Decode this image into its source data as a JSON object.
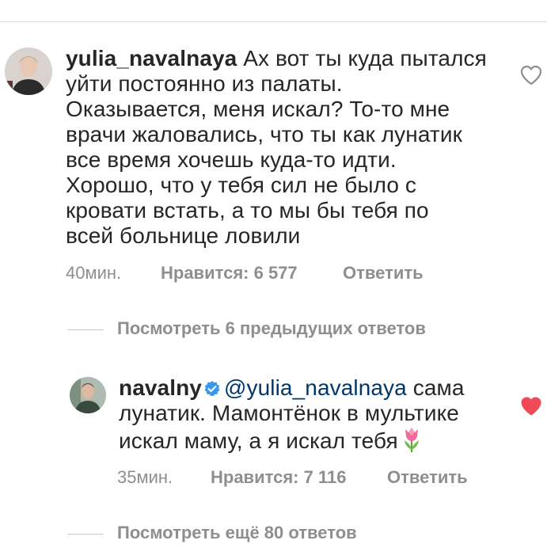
{
  "comments": [
    {
      "username": "yulia_navalnaya",
      "lines": [
        "Ах вот ты куда пытался",
        "уйти постоянно из палаты.",
        "Оказывается, меня искал? То-то мне",
        "врачи жаловались, что ты как лунатик",
        "все время хочешь куда-то идти.",
        "Хорошо, что у тебя сил не было с",
        "кровати встать, а то мы бы тебя по",
        "всей больнице ловили"
      ],
      "time": "40мин.",
      "likes": "Нравится: 6 577",
      "reply_label": "Ответить",
      "liked": false,
      "heart_color": "#8e8e8e"
    },
    {
      "username": "navalny",
      "verified": true,
      "mention": "@yulia_navalnaya",
      "line1_rest": "сама",
      "line2": "лунатик. Мамонтёнок в мультике",
      "line3": "искал маму, а я искал тебя",
      "emoji": "tulip-icon",
      "time": "35мин.",
      "likes": "Нравится: 7 116",
      "reply_label": "Ответить",
      "liked": true,
      "heart_color": "#ed4956"
    }
  ],
  "view_replies": [
    "Посмотреть 6 предыдущих ответов",
    "Посмотреть ещё 80 ответов"
  ],
  "colors": {
    "text": "#262626",
    "secondary": "#8e8e8e",
    "mention": "#00376b",
    "verified": "#3897f0",
    "liked": "#ed4956"
  }
}
